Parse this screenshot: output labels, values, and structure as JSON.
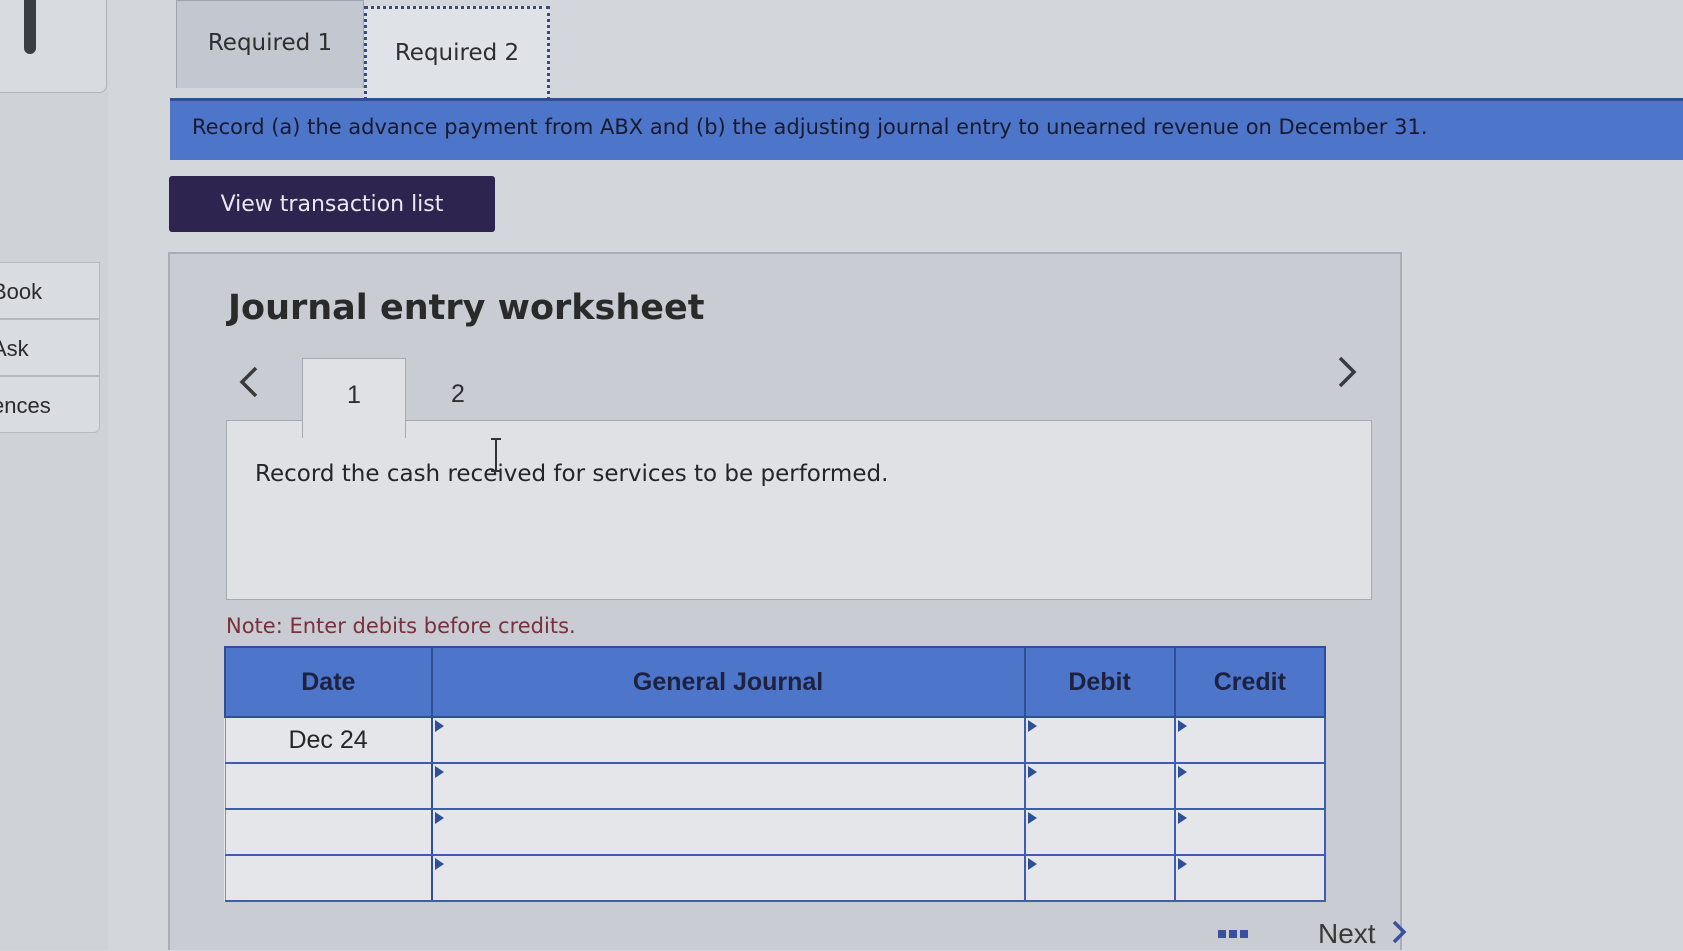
{
  "tabs": {
    "required1": "Required 1",
    "required2": "Required 2"
  },
  "banner": {
    "text": "Record (a) the advance payment from ABX and (b) the adjusting journal entry to unearned revenue on December 31."
  },
  "view_transaction_button": "View transaction list",
  "sidebar": {
    "items": [
      {
        "label": "Book"
      },
      {
        "label": "Ask"
      },
      {
        "label": "ences"
      }
    ]
  },
  "worksheet": {
    "title": "Journal entry worksheet",
    "prev_icon": "chevron-left-icon",
    "next_icon": "chevron-right-icon",
    "entry_tabs": [
      "1",
      "2"
    ],
    "instruction": "Record the cash received for services to be performed.",
    "note": "Note: Enter debits before credits."
  },
  "journal_table": {
    "headers": {
      "date": "Date",
      "general_journal": "General Journal",
      "debit": "Debit",
      "credit": "Credit"
    },
    "rows": [
      {
        "date": "Dec 24",
        "account": "",
        "debit": "",
        "credit": ""
      },
      {
        "date": "",
        "account": "",
        "debit": "",
        "credit": ""
      },
      {
        "date": "",
        "account": "",
        "debit": "",
        "credit": ""
      },
      {
        "date": "",
        "account": "",
        "debit": "",
        "credit": ""
      }
    ]
  },
  "footer": {
    "grid_icon": "grid-icon",
    "next_label": "Next"
  },
  "colors": {
    "accent_blue": "#4d75c9",
    "button_dark": "#2d2450",
    "note_red": "#7a2f3a"
  }
}
